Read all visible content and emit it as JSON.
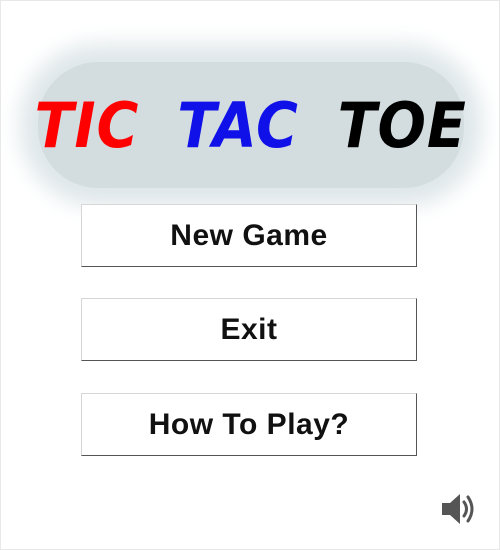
{
  "title": {
    "words": [
      {
        "text": "TIC",
        "color": "#ff0000"
      },
      {
        "text": "TAC",
        "color": "#1010e8"
      },
      {
        "text": "TOE",
        "color": "#000000"
      }
    ],
    "banner_color": "#d3dde0"
  },
  "menu": {
    "new_game_label": "New Game",
    "exit_label": "Exit",
    "how_to_play_label": "How To Play?"
  },
  "sound": {
    "icon": "speaker-icon",
    "icon_color": "#555555"
  }
}
